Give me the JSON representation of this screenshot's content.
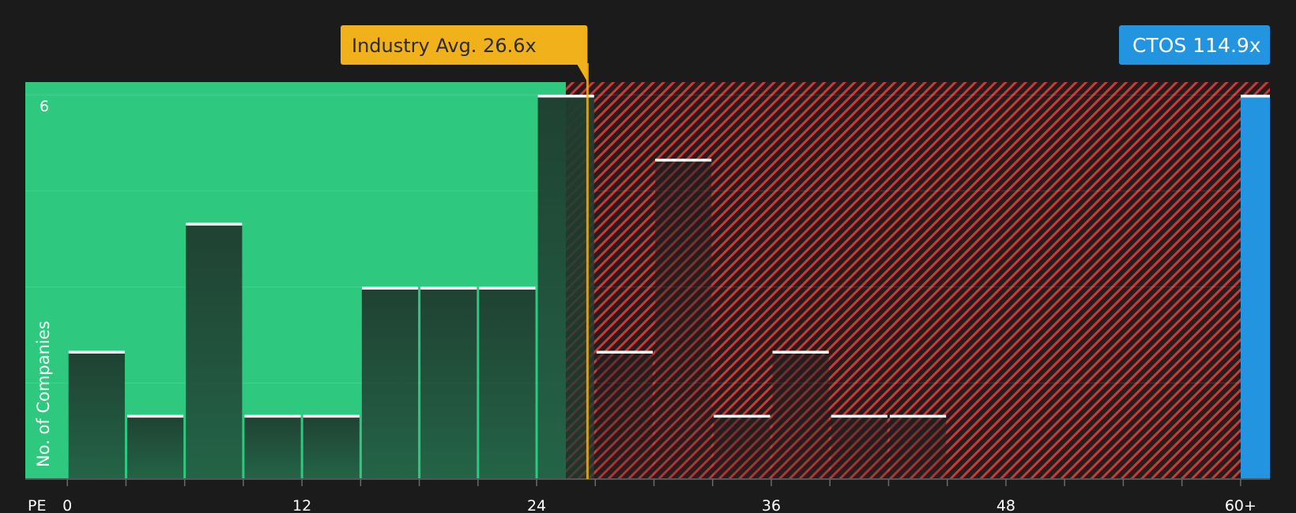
{
  "chart_data": {
    "type": "bar",
    "title": "",
    "xlabel": "PE",
    "ylabel": "No. of Companies",
    "x_tick_labels": [
      {
        "value": 0,
        "label": "0"
      },
      {
        "value": 12,
        "label": "12"
      },
      {
        "value": 24,
        "label": "24"
      },
      {
        "value": 36,
        "label": "36"
      },
      {
        "value": 48,
        "label": "48"
      },
      {
        "value": 60,
        "label": "60+"
      }
    ],
    "y_tick_labels": [
      {
        "value": 6,
        "label": "6"
      }
    ],
    "xlim": [
      -2.15,
      61.5
    ],
    "ylim": [
      0,
      6.2
    ],
    "bin_width": 3,
    "bins": [
      {
        "start": 0,
        "count": 2
      },
      {
        "start": 3,
        "count": 1
      },
      {
        "start": 6,
        "count": 4
      },
      {
        "start": 9,
        "count": 1
      },
      {
        "start": 12,
        "count": 1
      },
      {
        "start": 15,
        "count": 3
      },
      {
        "start": 18,
        "count": 3
      },
      {
        "start": 21,
        "count": 3
      },
      {
        "start": 24,
        "count": 6
      },
      {
        "start": 27,
        "count": 2
      },
      {
        "start": 30,
        "count": 5
      },
      {
        "start": 33,
        "count": 1
      },
      {
        "start": 36,
        "count": 2
      },
      {
        "start": 39,
        "count": 1
      },
      {
        "start": 42,
        "count": 1
      }
    ],
    "industry_avg": {
      "value": 26.6,
      "label": "Industry Avg. 26.6x"
    },
    "fair_zone_end": 25.5,
    "subject": {
      "name": "CTOS",
      "value": 114.9,
      "label": "CTOS 114.9x",
      "count": 6
    },
    "colors": {
      "background": "#1b1b1b",
      "good_zone": "#2ec97f",
      "bad_hatch": "#d03b3b",
      "bar_dark": "#1f3a2e",
      "industry": "#f0b11b",
      "subject": "#2394e0",
      "axis_text": "#ffffff"
    }
  }
}
